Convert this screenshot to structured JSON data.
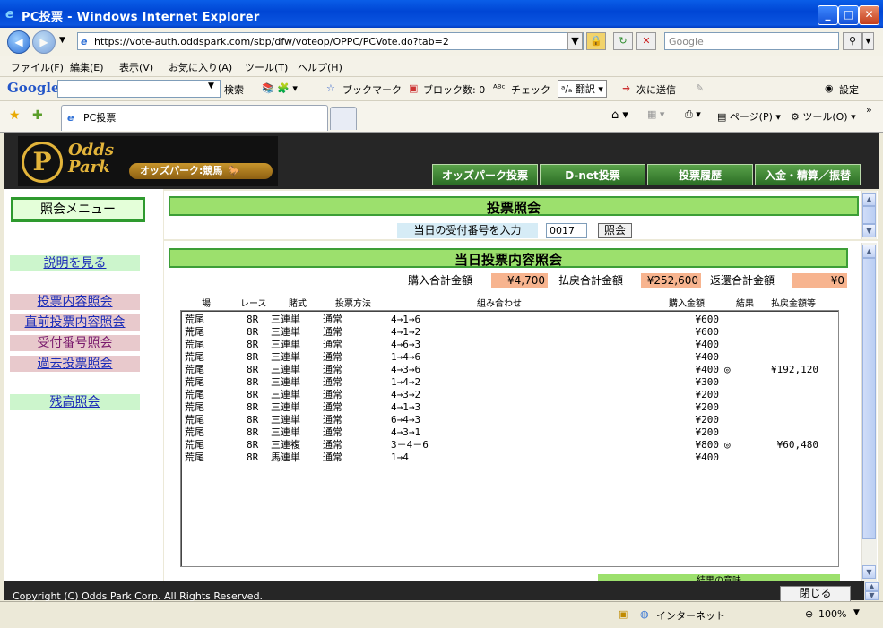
{
  "window": {
    "title": "PC投票 - Windows Internet Explorer"
  },
  "browser": {
    "url": "https://vote-auth.oddspark.com/sbp/dfw/voteop/OPPC/PCVote.do?tab=2",
    "search_placeholder": "Google"
  },
  "menu": [
    "ファイル(F)",
    "編集(E)",
    "表示(V)",
    "お気に入り(A)",
    "ツール(T)",
    "ヘルプ(H)"
  ],
  "google_toolbar": {
    "brand": "Google",
    "search_label": "検索",
    "bookmarks": "ブックマーク",
    "blocked": "ブロック数: 0",
    "check": "チェック",
    "translate": "翻訳",
    "send": "次に送信",
    "settings": "設定"
  },
  "tabs": {
    "active_label": "PC投票"
  },
  "command_bar": {
    "page": "ページ(P)",
    "tools": "ツール(O)"
  },
  "header": {
    "logo_text": "Odds Park",
    "logo_sub": "オッズパーク:競馬",
    "nav": [
      "オッズパーク投票",
      "D-net投票",
      "投票履歴",
      "入金・精算／振替"
    ]
  },
  "left_menu": {
    "title": "照会メニュー",
    "links": [
      "説明を見る",
      "投票内容照会",
      "直前投票内容照会",
      "受付番号照会",
      "過去投票照会",
      "残高照会"
    ]
  },
  "inquiry": {
    "title": "投票照会",
    "receipt_label": "当日の受付番号を入力",
    "receipt_value": "0017",
    "submit_label": "照会"
  },
  "results": {
    "title": "当日投票内容照会",
    "purchase_total_label": "購入合計金額",
    "purchase_total": "¥4,700",
    "payout_total_label": "払戻合計金額",
    "payout_total": "¥252,600",
    "refund_total_label": "返還合計金額",
    "refund_total": "¥0",
    "columns": [
      "場",
      "レース",
      "賭式",
      "投票方法",
      "組み合わせ",
      "購入金額",
      "結果",
      "払戻金額等"
    ],
    "rows": [
      {
        "venue": "荒尾",
        "race": "8R",
        "bet": "三連単",
        "method": "通常",
        "combo": "4→1→6",
        "amount": "¥600",
        "result": "",
        "payout": ""
      },
      {
        "venue": "荒尾",
        "race": "8R",
        "bet": "三連単",
        "method": "通常",
        "combo": "4→1→2",
        "amount": "¥600",
        "result": "",
        "payout": ""
      },
      {
        "venue": "荒尾",
        "race": "8R",
        "bet": "三連単",
        "method": "通常",
        "combo": "4→6→3",
        "amount": "¥400",
        "result": "",
        "payout": ""
      },
      {
        "venue": "荒尾",
        "race": "8R",
        "bet": "三連単",
        "method": "通常",
        "combo": "1→4→6",
        "amount": "¥400",
        "result": "",
        "payout": ""
      },
      {
        "venue": "荒尾",
        "race": "8R",
        "bet": "三連単",
        "method": "通常",
        "combo": "4→3→6",
        "amount": "¥400",
        "result": "◎",
        "payout": "¥192,120"
      },
      {
        "venue": "荒尾",
        "race": "8R",
        "bet": "三連単",
        "method": "通常",
        "combo": "1→4→2",
        "amount": "¥300",
        "result": "",
        "payout": ""
      },
      {
        "venue": "荒尾",
        "race": "8R",
        "bet": "三連単",
        "method": "通常",
        "combo": "4→3→2",
        "amount": "¥200",
        "result": "",
        "payout": ""
      },
      {
        "venue": "荒尾",
        "race": "8R",
        "bet": "三連単",
        "method": "通常",
        "combo": "4→1→3",
        "amount": "¥200",
        "result": "",
        "payout": ""
      },
      {
        "venue": "荒尾",
        "race": "8R",
        "bet": "三連単",
        "method": "通常",
        "combo": "6→4→3",
        "amount": "¥200",
        "result": "",
        "payout": ""
      },
      {
        "venue": "荒尾",
        "race": "8R",
        "bet": "三連単",
        "method": "通常",
        "combo": "4→3→1",
        "amount": "¥200",
        "result": "",
        "payout": ""
      },
      {
        "venue": "荒尾",
        "race": "8R",
        "bet": "三連複",
        "method": "通常",
        "combo": "3－4－6",
        "amount": "¥800",
        "result": "◎",
        "payout": "¥60,480"
      },
      {
        "venue": "荒尾",
        "race": "8R",
        "bet": "馬連単",
        "method": "通常",
        "combo": "1→4",
        "amount": "¥400",
        "result": "",
        "payout": ""
      }
    ],
    "partial_caption": "結果の意味"
  },
  "footer": {
    "copyright": "Copyright (C) Odds Park Corp. All Rights Reserved.",
    "close_label": "閉じる"
  },
  "status": {
    "zone": "インターネット",
    "zoom": "100%"
  },
  "colors": {
    "accent_green": "#9ce06d",
    "header_bg": "#262626",
    "gold": "#e3b43a",
    "sum_orange": "#f7b48f"
  }
}
